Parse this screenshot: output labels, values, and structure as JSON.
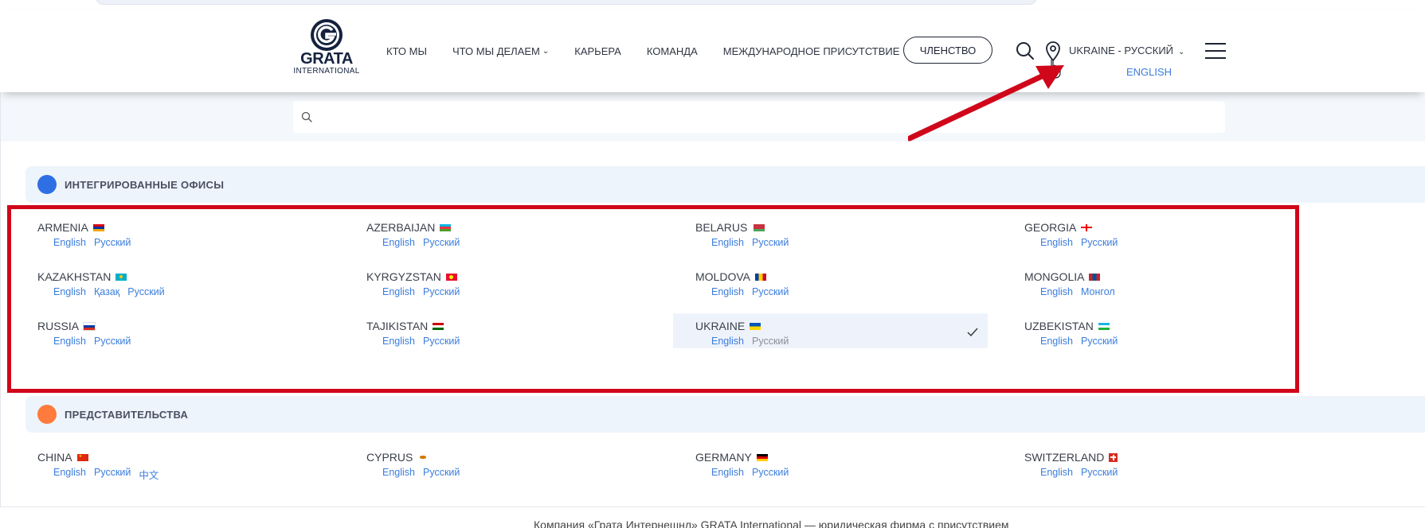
{
  "logo": {
    "brand": "GRATA",
    "sub": "INTERNATIONAL",
    "icon": "grata-g-logo-icon"
  },
  "nav": {
    "items": [
      {
        "label": "КТО МЫ",
        "has_dropdown": false
      },
      {
        "label": "ЧТО МЫ ДЕЛАЕМ",
        "has_dropdown": true
      },
      {
        "label": "КАРЬЕРА",
        "has_dropdown": false
      },
      {
        "label": "КОМАНДА",
        "has_dropdown": false
      },
      {
        "label": "МЕЖДУНАРОДНОЕ ПРИСУТСТВИЕ",
        "has_dropdown": false
      }
    ],
    "membership_label": "ЧЛЕНСТВО",
    "location_label": "UKRAINE - РУССКИЙ",
    "alt_language": "ENGLISH"
  },
  "search": {
    "placeholder": "",
    "value": ""
  },
  "sections": {
    "integrated": {
      "label": "ИНТЕГРИРОВАННЫЕ ОФИСЫ",
      "dot_color": "#2f6fe4"
    },
    "representative": {
      "label": "ПРЕДСТАВИТЕЛЬСТВА",
      "dot_color": "#ff7a3d"
    }
  },
  "integrated_offices": [
    {
      "name": "ARMENIA",
      "flag": "armenia",
      "langs": [
        "English",
        "Русский"
      ]
    },
    {
      "name": "AZERBAIJAN",
      "flag": "azerbaijan",
      "langs": [
        "English",
        "Русский"
      ]
    },
    {
      "name": "BELARUS",
      "flag": "belarus",
      "langs": [
        "English",
        "Русский"
      ]
    },
    {
      "name": "GEORGIA",
      "flag": "georgia",
      "langs": [
        "English",
        "Русский"
      ]
    },
    {
      "name": "KAZAKHSTAN",
      "flag": "kazakhstan",
      "langs": [
        "English",
        "Қазақ",
        "Русский"
      ]
    },
    {
      "name": "KYRGYZSTAN",
      "flag": "kyrgyzstan",
      "langs": [
        "English",
        "Русский"
      ]
    },
    {
      "name": "MOLDOVA",
      "flag": "moldova",
      "langs": [
        "English",
        "Русский"
      ]
    },
    {
      "name": "MONGOLIA",
      "flag": "mongolia",
      "langs": [
        "English",
        "Монгол"
      ]
    },
    {
      "name": "RUSSIA",
      "flag": "russia",
      "langs": [
        "English",
        "Русский"
      ]
    },
    {
      "name": "TAJIKISTAN",
      "flag": "tajikistan",
      "langs": [
        "English",
        "Русский"
      ]
    },
    {
      "name": "UKRAINE",
      "flag": "ukraine",
      "langs": [
        "English",
        "Русский"
      ],
      "selected": true
    },
    {
      "name": "UZBEKISTAN",
      "flag": "uzbekistan",
      "langs": [
        "English",
        "Русский"
      ]
    }
  ],
  "representative_offices": [
    {
      "name": "CHINA",
      "flag": "china",
      "langs": [
        "English",
        "Русский",
        "中文"
      ]
    },
    {
      "name": "CYPRUS",
      "flag": "cyprus",
      "langs": [
        "English",
        "Русский"
      ]
    },
    {
      "name": "GERMANY",
      "flag": "germany",
      "langs": [
        "English",
        "Русский"
      ]
    },
    {
      "name": "SWITZERLAND",
      "flag": "switzerland",
      "langs": [
        "English",
        "Русский"
      ]
    }
  ],
  "colors": {
    "link": "#3b7ddd",
    "annotation_red": "#d0071a",
    "selected_bg": "#eef3fb"
  },
  "bottom_text": "Компания «Грата Интернешнл» GRATA International — юридическая фирма с присутствием"
}
